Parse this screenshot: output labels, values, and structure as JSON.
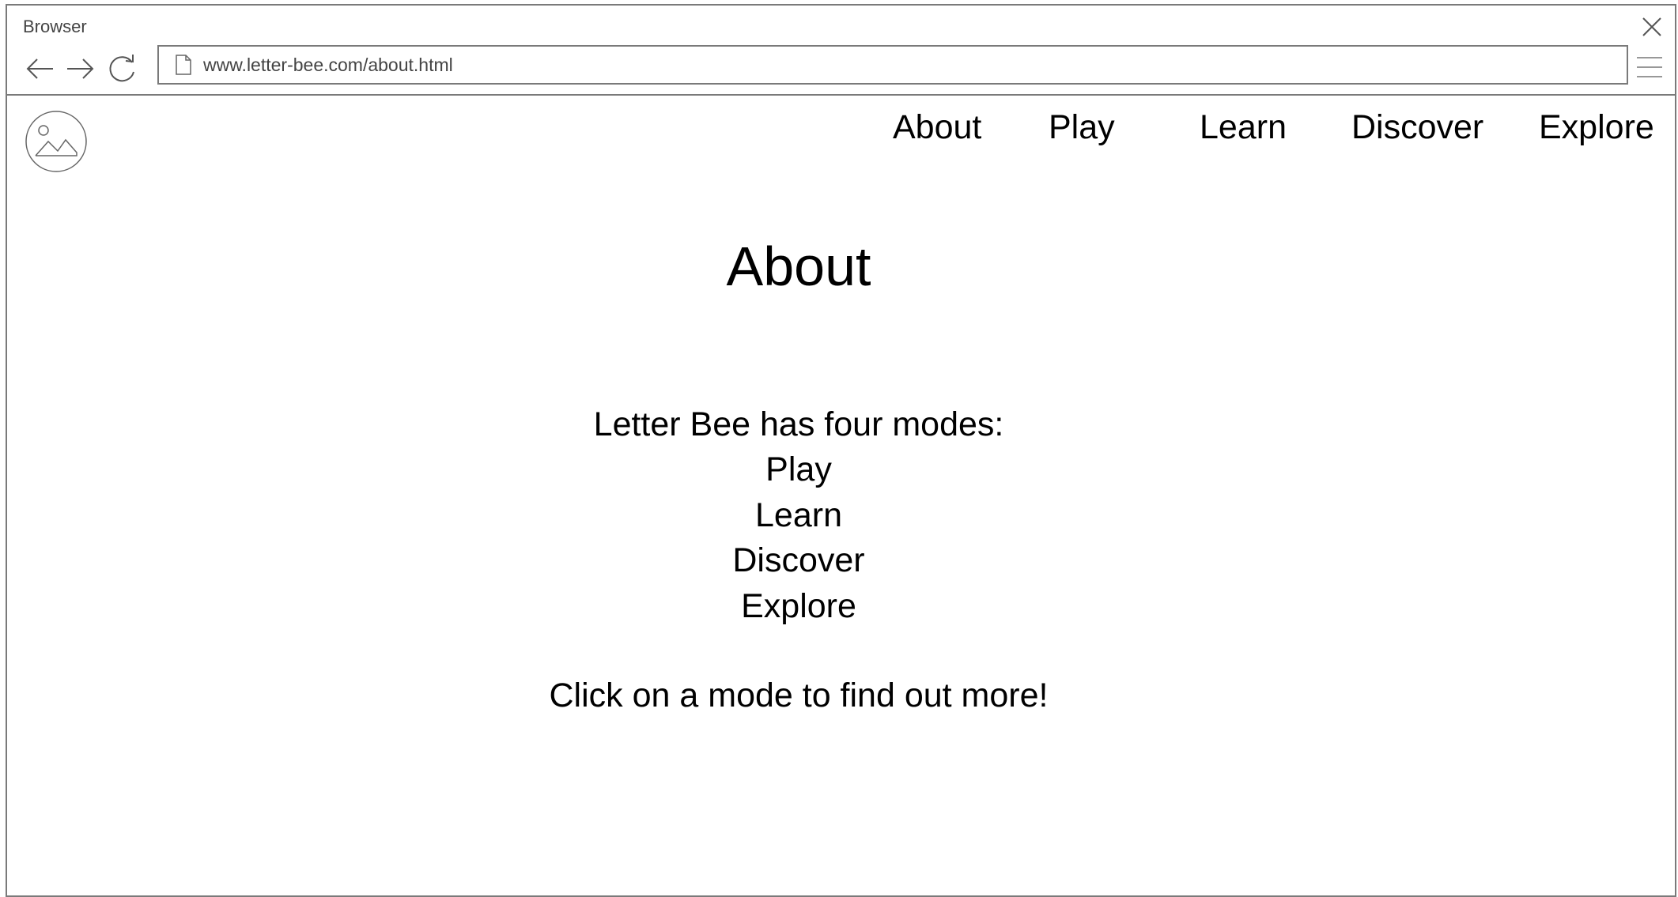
{
  "window": {
    "title": "Browser"
  },
  "address_bar": {
    "url": "www.letter-bee.com/about.html"
  },
  "nav": {
    "items": [
      {
        "label": "About"
      },
      {
        "label": "Play"
      },
      {
        "label": "Learn"
      },
      {
        "label": "Discover"
      },
      {
        "label": "Explore"
      }
    ]
  },
  "main": {
    "title": "About",
    "intro": "Letter Bee has four modes:",
    "modes": [
      "Play",
      "Learn",
      "Discover",
      "Explore"
    ],
    "cta": "Click on a mode to find out more!"
  },
  "icons": {
    "close": "close-icon",
    "back": "arrow-left-icon",
    "forward": "arrow-right-icon",
    "reload": "reload-icon",
    "page": "page-icon",
    "menu": "hamburger-menu-icon",
    "logo": "image-placeholder-icon"
  },
  "colors": {
    "frame": "#7a7a7a",
    "chrome_text": "#444444",
    "text": "#000000",
    "background": "#ffffff"
  }
}
